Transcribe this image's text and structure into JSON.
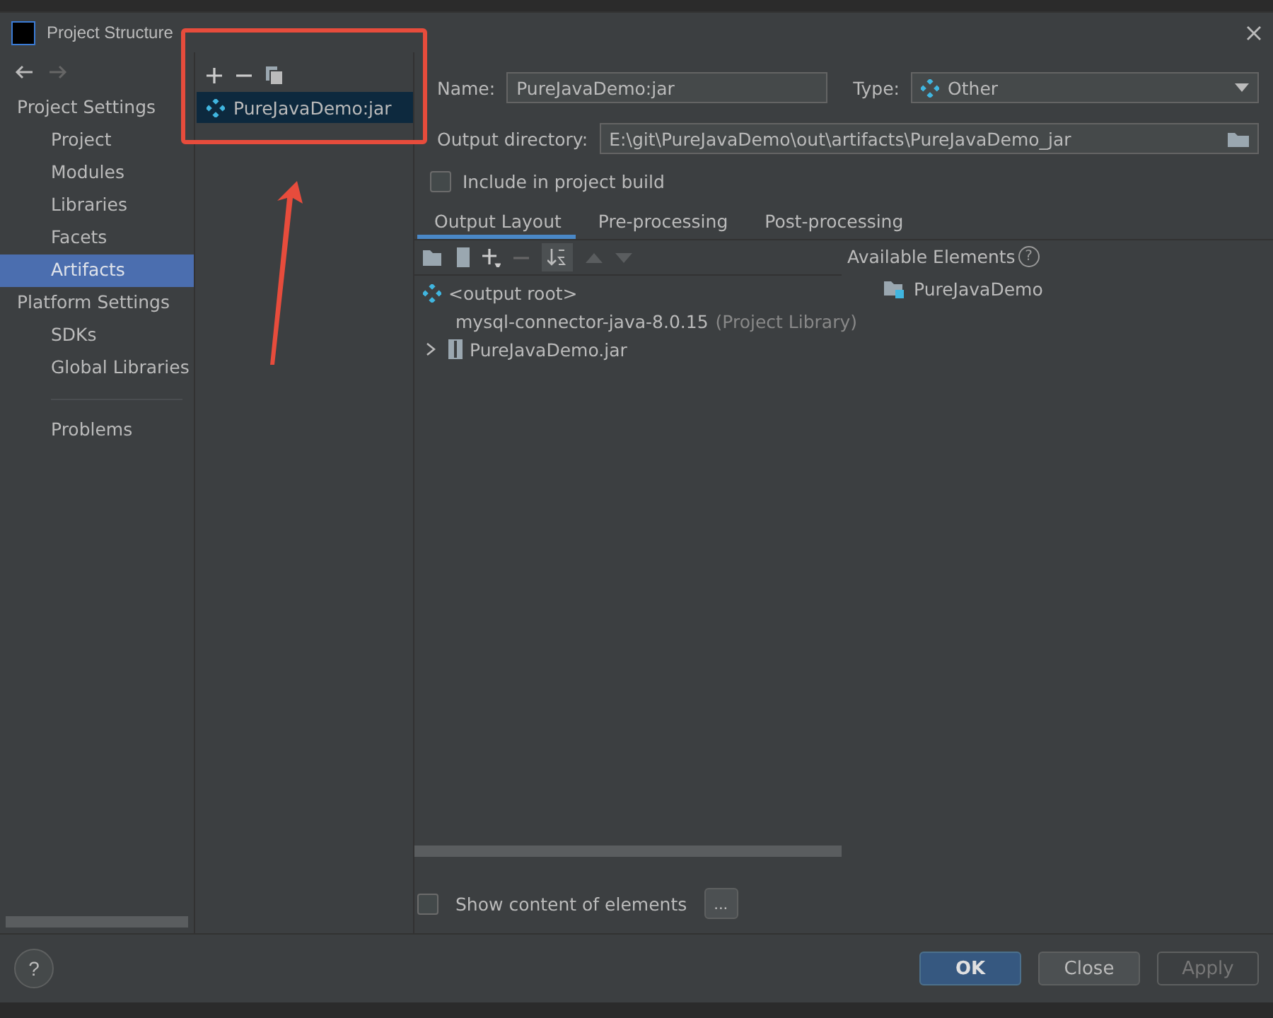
{
  "window": {
    "title": "Project Structure"
  },
  "sidebar": {
    "sections": [
      {
        "heading": "Project Settings",
        "items": [
          {
            "label": "Project",
            "selected": false
          },
          {
            "label": "Modules",
            "selected": false
          },
          {
            "label": "Libraries",
            "selected": false
          },
          {
            "label": "Facets",
            "selected": false
          },
          {
            "label": "Artifacts",
            "selected": true
          }
        ]
      },
      {
        "heading": "Platform Settings",
        "items": [
          {
            "label": "SDKs",
            "selected": false
          },
          {
            "label": "Global Libraries",
            "selected": false
          }
        ]
      }
    ],
    "footer_items": [
      {
        "label": "Problems",
        "selected": false
      }
    ]
  },
  "artifacts": [
    {
      "label": "PureJavaDemo:jar",
      "selected": true
    }
  ],
  "name_field": {
    "label": "Name:",
    "value": "PureJavaDemo:jar"
  },
  "type_field": {
    "label": "Type:",
    "value": "Other"
  },
  "output_directory": {
    "label": "Output directory:",
    "value": "E:\\git\\PureJavaDemo\\out\\artifacts\\PureJavaDemo_jar"
  },
  "include_in_build": {
    "label": "Include in project build",
    "checked": false
  },
  "tabs": [
    {
      "label": "Output Layout",
      "selected": true
    },
    {
      "label": "Pre-processing",
      "selected": false
    },
    {
      "label": "Post-processing",
      "selected": false
    }
  ],
  "layout_tree": [
    {
      "label": "<output root>",
      "kind": "root",
      "children": [
        {
          "label": "mysql-connector-java-8.0.15",
          "note": "(Project Library)",
          "kind": "library"
        },
        {
          "label": "PureJavaDemo.jar",
          "kind": "jar",
          "expanded": false
        }
      ]
    }
  ],
  "available_elements": {
    "heading": "Available Elements",
    "help_mark": "?",
    "items": [
      {
        "label": "PureJavaDemo"
      }
    ]
  },
  "help_button": "?",
  "show_content": {
    "label": "Show content of elements",
    "checked": false
  },
  "more_button": "...",
  "buttons": [
    {
      "label": "OK",
      "kind": "primary",
      "disabled": false
    },
    {
      "label": "Close",
      "kind": "normal",
      "disabled": false
    },
    {
      "label": "Apply",
      "kind": "normal",
      "disabled": true
    }
  ]
}
